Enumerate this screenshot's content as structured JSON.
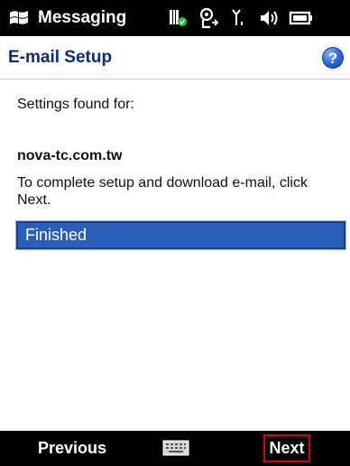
{
  "titlebar": {
    "app_title": "Messaging",
    "start_icon": "windows-flag-icon",
    "status_icons": [
      "sim-card-icon",
      "connectivity-icon",
      "signal-strength-icon",
      "volume-icon",
      "battery-icon"
    ]
  },
  "header": {
    "title": "E-mail Setup",
    "help_label": "?"
  },
  "content": {
    "settings_found": "Settings found for:",
    "domain": "nova-tc.com.tw",
    "instruction": "To complete setup and download e-mail, click Next.",
    "status_value": "Finished"
  },
  "softkeys": {
    "left_label": "Previous",
    "center_icon": "keyboard-icon",
    "right_label": "Next"
  },
  "colors": {
    "header_title": "#0d2c7a",
    "status_field_bg": "#2a5fb9",
    "next_highlight": "#e00000"
  }
}
